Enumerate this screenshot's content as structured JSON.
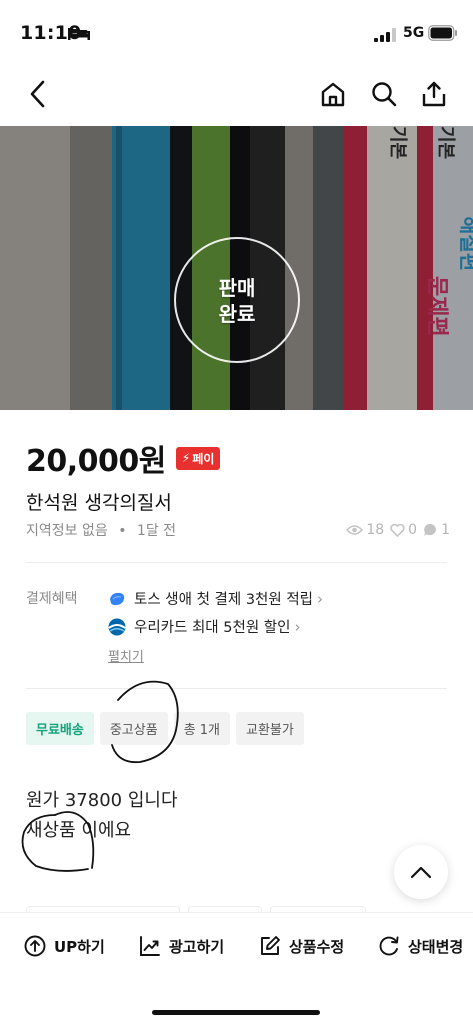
{
  "status_bar": {
    "time": "11:10",
    "network": "5G"
  },
  "nav": {
    "back_icon": "chevron-left-icon",
    "home_icon": "home-icon",
    "search_icon": "search-icon",
    "share_icon": "share-icon"
  },
  "image": {
    "sold_badge_line1": "판매",
    "sold_badge_line2": "완료"
  },
  "product": {
    "price": "20,000원",
    "pay_badge": "페이",
    "title": "한석원 생각의질서",
    "location": "지역정보 없음",
    "separator": "•",
    "time_ago": "1달 전",
    "views": "18",
    "likes": "0",
    "chats": "1"
  },
  "benefits": {
    "label": "결제혜택",
    "items": [
      {
        "text": "토스 생애 첫 결제 3천원 적립",
        "logo_color": "#3182f6"
      },
      {
        "text": "우리카드 최대 5천원 할인",
        "logo_color": "#0067ac"
      }
    ],
    "expand": "펼치기"
  },
  "tags": [
    "무료배송",
    "중고상품",
    "총 1개",
    "교환불가"
  ],
  "description": {
    "line1": "원가 37800 입니다",
    "line2": "새상품 이에요"
  },
  "actions": [
    {
      "label": "UP하기",
      "icon": "arrow-up-circle-icon"
    },
    {
      "label": "광고하기",
      "icon": "trend-chart-icon"
    },
    {
      "label": "상품수정",
      "icon": "edit-icon"
    },
    {
      "label": "상태변경",
      "icon": "refresh-icon"
    }
  ],
  "colors": {
    "accent_red": "#e8312f",
    "free_tag_green": "#14a37a",
    "free_tag_bg": "#e6f7f1"
  }
}
